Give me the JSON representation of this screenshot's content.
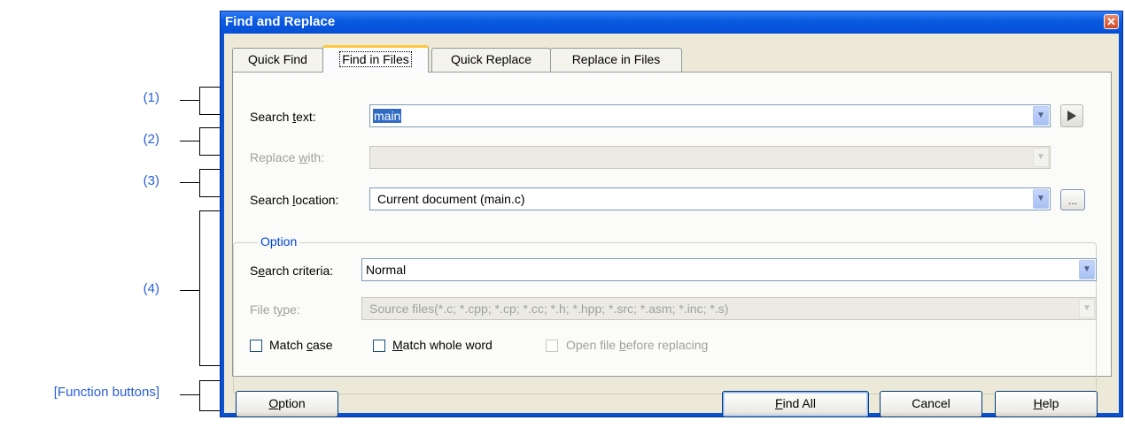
{
  "callouts": [
    "(1)",
    "(2)",
    "(3)",
    "(4)",
    "[Function buttons]"
  ],
  "window": {
    "title": "Find and Replace",
    "close_glyph": "✕"
  },
  "tabs": [
    "Quick Find",
    "Find in Files",
    "Quick Replace",
    "Replace in Files"
  ],
  "active_tab": "Find in Files",
  "search_text": {
    "label_pre": "Search ",
    "label_u": "t",
    "label_post": "ext:",
    "value": "main"
  },
  "replace_with": {
    "label_pre": "Replace ",
    "label_u": "w",
    "label_post": "ith:",
    "value": ""
  },
  "search_location": {
    "label_pre": "Search ",
    "label_u": "l",
    "label_post": "ocation:",
    "value": "Current document (main.c)",
    "browse_label": "..."
  },
  "option_group": {
    "title": "Option",
    "criteria": {
      "label_pre": "S",
      "label_u": "e",
      "label_post": "arch criteria:",
      "value": "Normal"
    },
    "file_type": {
      "label_pre": "File t",
      "label_u": "y",
      "label_post": "pe:",
      "value": "Source files(*.c; *.cpp; *.cp; *.cc; *.h; *.hpp; *.src; *.asm; *.inc; *.s)"
    },
    "match_case": {
      "label_pre": "Match ",
      "label_u": "c",
      "label_post": "ase",
      "checked": false
    },
    "match_whole_word": {
      "label_pre": "",
      "label_u": "M",
      "label_post": "atch whole word",
      "checked": false
    },
    "open_file": {
      "label_pre": "Open file ",
      "label_u": "b",
      "label_post": "efore replacing",
      "checked": false
    }
  },
  "buttons": {
    "option": {
      "u": "O",
      "rest": "ption"
    },
    "find_all": {
      "u": "F",
      "rest": "ind All"
    },
    "cancel": "Cancel",
    "help": {
      "u": "H",
      "rest": "elp"
    }
  },
  "colors": {
    "callout": "#2a5ed8",
    "titlebar": "#0a5ae0",
    "group_title": "#0046d5"
  },
  "icons": {
    "run": "play-arrow-icon",
    "dropdown": "chevron-down-icon"
  }
}
